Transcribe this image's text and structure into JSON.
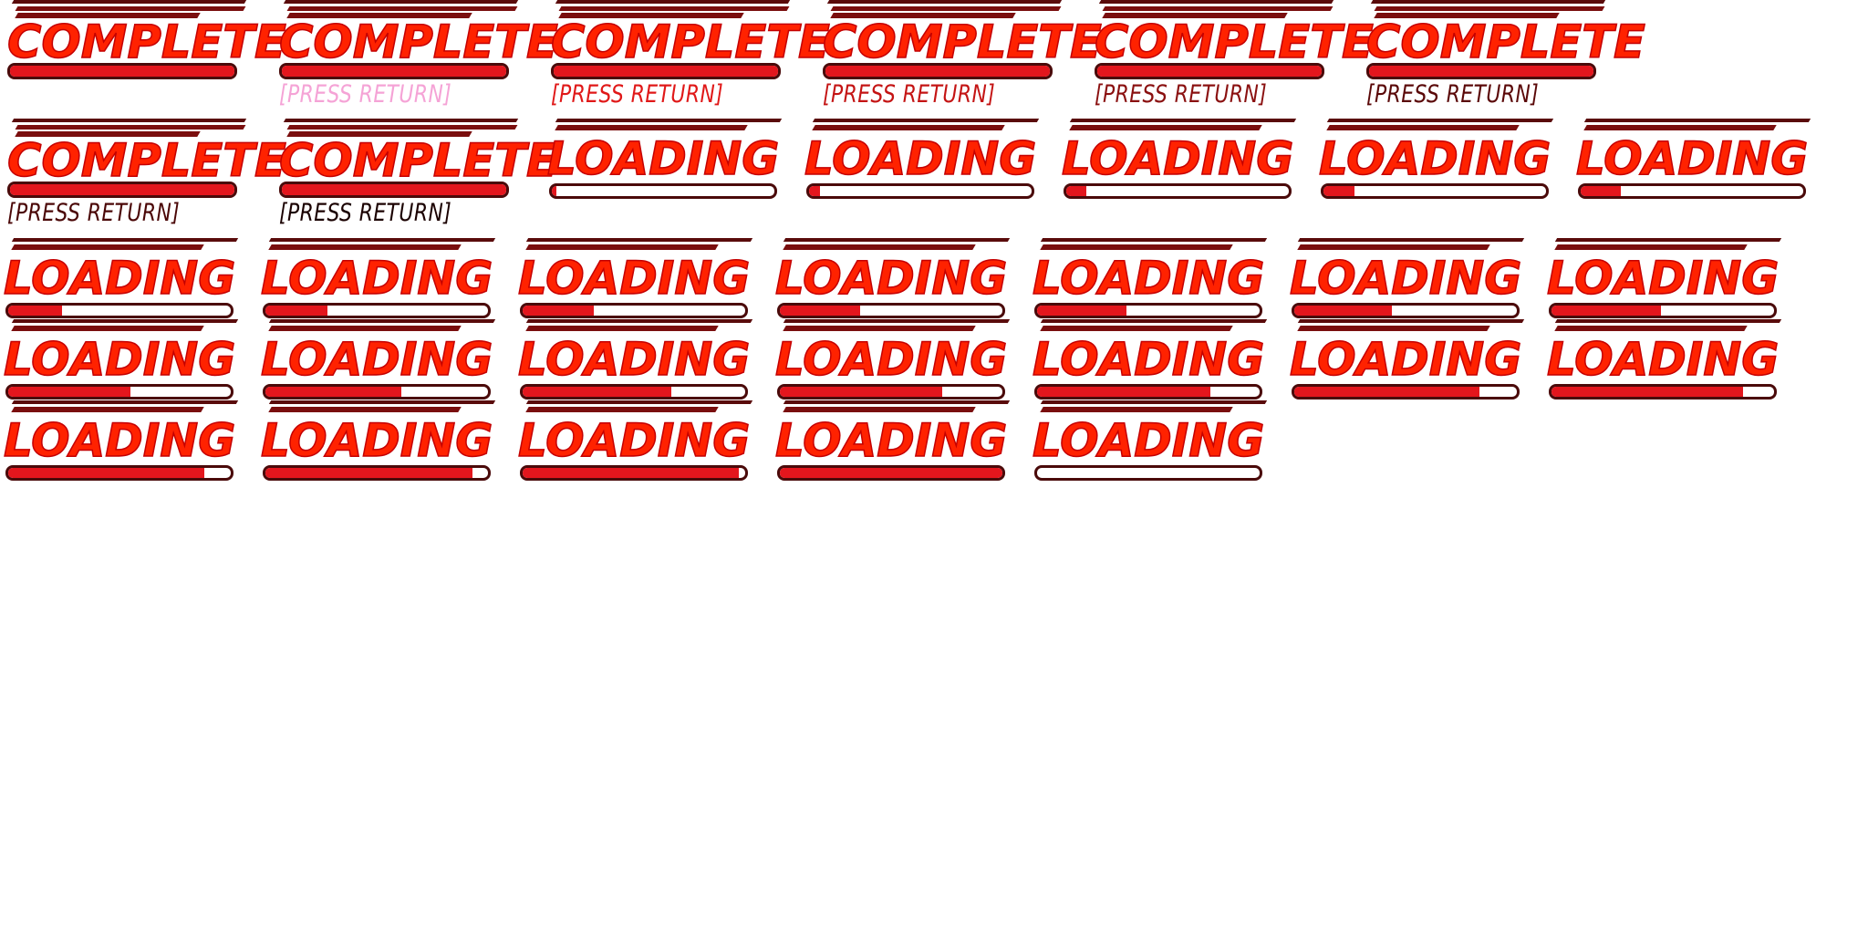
{
  "sheet": {
    "complete_title": "COMPLETE",
    "loading_title": "LOADING",
    "prompt_text": "[PRESS RETURN]",
    "colors": {
      "title_fill": "#ff2200",
      "title_outline": "#c40000",
      "bar_fill": "#e3161d",
      "bar_border": "#4a0a0a",
      "deco_dark": "#5a0b0b",
      "deco_mid": "#7a0e0e"
    }
  },
  "complete_frames": [
    {
      "title": "COMPLETE",
      "prompt": "",
      "prompt_color": ""
    },
    {
      "title": "COMPLETE",
      "prompt": "[PRESS RETURN]",
      "prompt_color": "#f5a3d6"
    },
    {
      "title": "COMPLETE",
      "prompt": "[PRESS RETURN]",
      "prompt_color": "#e01818"
    },
    {
      "title": "COMPLETE",
      "prompt": "[PRESS RETURN]",
      "prompt_color": "#c41414"
    },
    {
      "title": "COMPLETE",
      "prompt": "[PRESS RETURN]",
      "prompt_color": "#8a1010"
    },
    {
      "title": "COMPLETE",
      "prompt": "[PRESS RETURN]",
      "prompt_color": "#5a0808"
    },
    {
      "title": "COMPLETE",
      "prompt": "[PRESS RETURN]",
      "prompt_color": "#4a0606"
    },
    {
      "title": "COMPLETE",
      "prompt": "[PRESS RETURN]",
      "prompt_color": "#1a0000"
    }
  ],
  "loading_frames": [
    {
      "title": "LOADING",
      "progress": 0.02
    },
    {
      "title": "LOADING",
      "progress": 0.05
    },
    {
      "title": "LOADING",
      "progress": 0.09
    },
    {
      "title": "LOADING",
      "progress": 0.14
    },
    {
      "title": "LOADING",
      "progress": 0.18
    },
    {
      "title": "LOADING",
      "progress": 0.24
    },
    {
      "title": "LOADING",
      "progress": 0.28
    },
    {
      "title": "LOADING",
      "progress": 0.32
    },
    {
      "title": "LOADING",
      "progress": 0.36
    },
    {
      "title": "LOADING",
      "progress": 0.4
    },
    {
      "title": "LOADING",
      "progress": 0.44
    },
    {
      "title": "LOADING",
      "progress": 0.49
    },
    {
      "title": "LOADING",
      "progress": 0.55
    },
    {
      "title": "LOADING",
      "progress": 0.61
    },
    {
      "title": "LOADING",
      "progress": 0.67
    },
    {
      "title": "LOADING",
      "progress": 0.73
    },
    {
      "title": "LOADING",
      "progress": 0.78
    },
    {
      "title": "LOADING",
      "progress": 0.83
    },
    {
      "title": "LOADING",
      "progress": 0.86
    },
    {
      "title": "LOADING",
      "progress": 0.88
    },
    {
      "title": "LOADING",
      "progress": 0.93
    },
    {
      "title": "LOADING",
      "progress": 0.97
    },
    {
      "title": "LOADING",
      "progress": 1.0
    },
    {
      "title": "LOADING",
      "progress": 0.0
    }
  ]
}
